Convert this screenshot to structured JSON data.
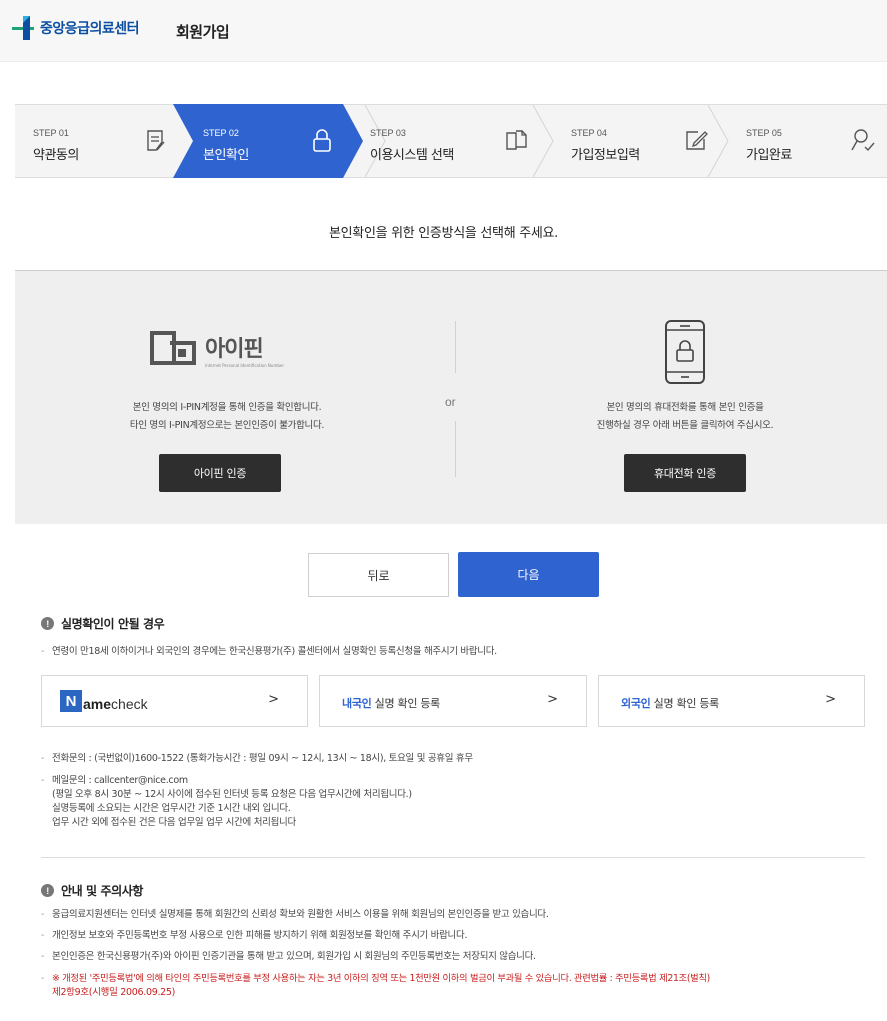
{
  "header": {
    "logo_text": "중앙응급의료센터",
    "title": "회원가입"
  },
  "steps": [
    {
      "num": "STEP 01",
      "label": "약관동의",
      "icon": "document-edit-icon"
    },
    {
      "num": "STEP 02",
      "label": "본인확인",
      "icon": "lock-icon",
      "active": true
    },
    {
      "num": "STEP 03",
      "label": "이용시스템 선택",
      "icon": "copy-pages-icon"
    },
    {
      "num": "STEP 04",
      "label": "가입정보입력",
      "icon": "edit-box-icon"
    },
    {
      "num": "STEP 05",
      "label": "가입완료",
      "icon": "user-check-icon"
    }
  ],
  "instruction": "본인확인을 위한 인증방식을 선택해 주세요.",
  "auth": {
    "or": "or",
    "ipin": {
      "logo_text": "아이핀",
      "logo_sub": "Internet Personal Identification Number",
      "desc_line1": "본인 명의의 I-PIN계정을 통해 인증을 확인합니다.",
      "desc_line2": "타인 명의 I-PIN계정으로는 본인인증이 불가합니다.",
      "button": "아이핀 인증"
    },
    "phone": {
      "desc_line1": "본인 명의의 휴대전화를 통해 본인 인증을",
      "desc_line2": "진행하실 경우 아래 버튼을 클릭하여 주십시오.",
      "button": "휴대전화 인증"
    }
  },
  "nav": {
    "back": "뒤로",
    "next": "다음"
  },
  "realname": {
    "title": "실명확인이 안될 경우",
    "note": "연령이 만18세 이하이거나 외국인의 경우에는 한국신용평가(주) 콜센터에서 실명확인 등록신청을 해주시기 바랍니다.",
    "cards": {
      "namecheck": {
        "n": "N",
        "ame": "ame",
        "check": "check",
        "arrow": ">"
      },
      "domestic": {
        "highlight": "내국인",
        "rest": " 실명 확인 등록",
        "arrow": ">"
      },
      "foreign": {
        "highlight": "외국인",
        "rest": " 실명 확인 등록",
        "arrow": ">"
      }
    },
    "phone_inquiry": "전화문의 : (국번없이)1600-1522 (통화가능시간 : 평일 09시 ~ 12시, 13시 ~ 18시), 토요일 및 공휴일 휴무",
    "mail_inquiry": "메일문의 : callcenter@nice.com",
    "mail_sub1": "(평일 오후 8시 30분 ~ 12시 사이에 접수된 인터넷 등록 요청은 다음 업무시간에 처리됩니다.)",
    "mail_sub2": "실명등록에 소요되는 시간은 업무시간 기준 1시간 내외 입니다.",
    "mail_sub3": "업무 시간 외에 접수된 건은 다음 업무일 업무 시간에 처리됩니다"
  },
  "notice": {
    "title": "안내 및 주의사항",
    "items": [
      "응급의료지원센터는 인터넷 실명제를 통해 회원간의 신뢰성 확보와 원활한 서비스 이용을 위해 회원님의 본인인증을 받고 있습니다.",
      "개인정보 보호와 주민등록번호 부정 사용으로 인한 피해를 방지하기 위해 회원정보를 확인해 주시기 바랍니다.",
      "본인인증은 한국신용평가(주)와 아이핀 인증기관을 통해 받고 있으며, 회원가입 시 회원님의 주민등록번호는 저장되지 않습니다."
    ],
    "warning_line1": "※ 개정된 '주민등록법'에 의해 타인의 주민등록번호를 부정 사용하는 자는 3년 이하의 징역 또는 1천만원 이하의 벌금이 부과될 수 있습니다. 관련법률 : 주민등록법 제21조(벌칙)",
    "warning_line2": "제2항9호(시행일 2006.09.25)"
  },
  "colors": {
    "primary": "#2f63d0",
    "dark_button": "#2e2e2e",
    "warning": "#c8201f"
  }
}
